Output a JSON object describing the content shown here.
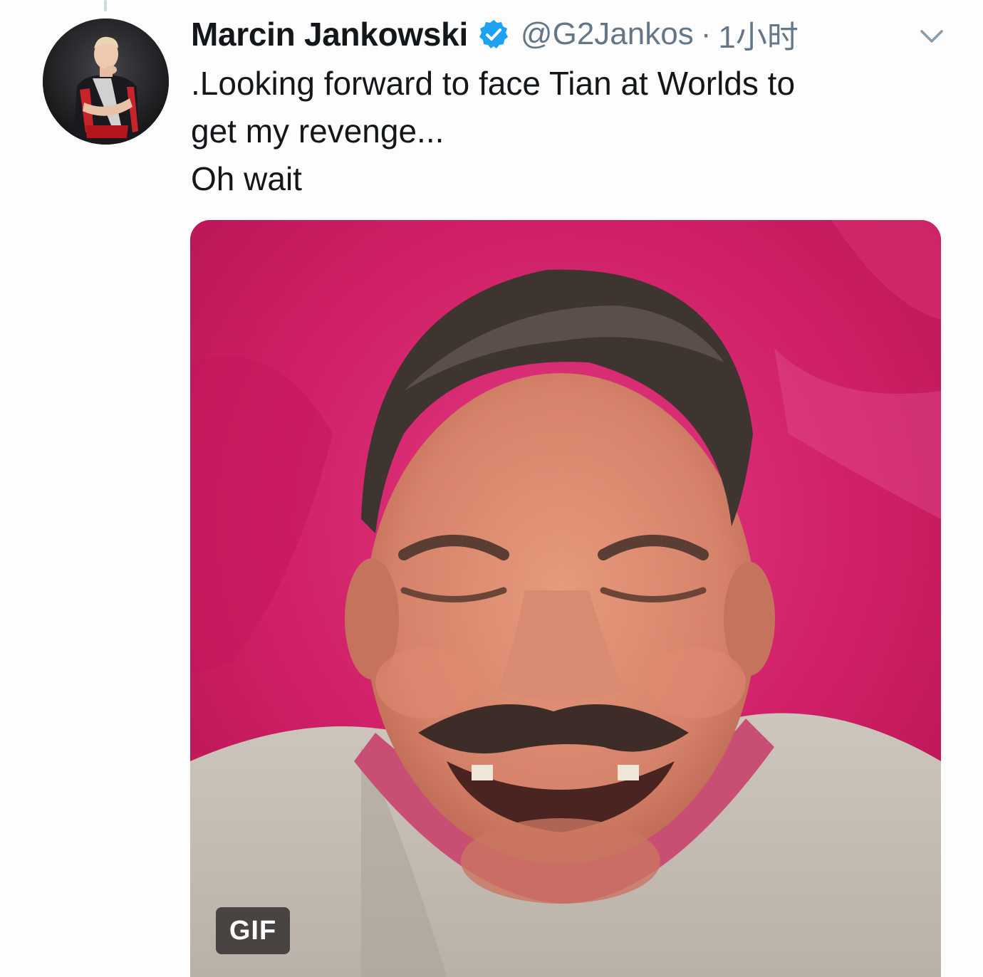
{
  "tweet": {
    "author": {
      "display_name": "Marcin Jankowski",
      "handle": "@G2Jankos",
      "verified": true
    },
    "separator": "·",
    "timestamp": "1小时",
    "text_lines": [
      ".Looking forward to face Tian at Worlds to",
      "get my revenge...",
      "Oh wait"
    ],
    "media": {
      "type": "gif",
      "badge_label": "GIF"
    }
  },
  "icons": {
    "verified": "verified-badge-icon",
    "menu": "chevron-down-icon"
  },
  "colors": {
    "verified_blue": "#1da1f2",
    "secondary_text": "#657786",
    "primary_text": "#14171a",
    "media_background": "#d3266e"
  }
}
